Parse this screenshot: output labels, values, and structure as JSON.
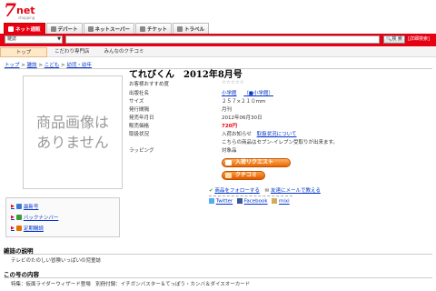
{
  "header": {
    "logo_seven": "7",
    "logo_net": "net",
    "logo_shopping": "shopping",
    "tabs": [
      {
        "label": "ネット通販",
        "active": true
      },
      {
        "label": "デパート",
        "active": false
      },
      {
        "label": "ネットスーパー",
        "active": false
      },
      {
        "label": "チケット",
        "active": false
      },
      {
        "label": "トラベル",
        "active": false
      }
    ]
  },
  "search": {
    "category": "雑誌",
    "placeholder": "",
    "button": "検 索",
    "advanced": "[詳細検索]"
  },
  "subnav": {
    "items": [
      "トップ",
      "こだわり専門店",
      "みんなのクチコミ"
    ]
  },
  "breadcrumb": {
    "top": "トップ",
    "magazine": "雑誌",
    "kids": "こども",
    "infant": "幼児・幼年",
    "sep": ">"
  },
  "product": {
    "no_image": "商品画像はありません",
    "title": "てれびくん　2012年8月号",
    "rows": [
      {
        "label": "お客様おすすめ度",
        "value": "☆☆☆☆☆"
      },
      {
        "label": "出版社名",
        "value": "小学館",
        "value2": "（■小学館）"
      },
      {
        "label": "サイズ",
        "value": "２５７×２１０mm"
      },
      {
        "label": "発行間隔",
        "value": "月刊"
      },
      {
        "label": "発売年月日",
        "value": "2012年06月30日"
      },
      {
        "label": "販売価格",
        "value": "720円"
      },
      {
        "label": "取扱状況",
        "value": "入荷お知らせ",
        "value2": "取扱状況について"
      },
      {
        "label": "",
        "value": "こちらの商品はセブン-イレブン受取りが出来ます。"
      },
      {
        "label": "ラッピング",
        "value": "対象品"
      }
    ],
    "btn_notify": "入荷リクエスト",
    "btn_review": "クチコミ",
    "follow": "商品をフォローする",
    "email": "友達にメールで教える",
    "twitter": "Twitter",
    "facebook": "Facebook",
    "mixi": "mixi"
  },
  "side_links": [
    {
      "label": "最新号",
      "color": "#3a7bd5"
    },
    {
      "label": "バックナンバー",
      "color": "#3a9a3a"
    },
    {
      "label": "定期購読",
      "color": "#e07000"
    }
  ],
  "sections": {
    "about_title": "雑誌の説明",
    "about_text": "テレビのたのしい冒険いっぱいの児童誌",
    "contents_title": "この号の内容",
    "contents_text": "特集：仮面ライダーウィザード登場　別冊付録：イチガンバスター＆てっぽう・カンバ＆ダイスオーカード"
  },
  "colors": {
    "brand_red": "#e60012",
    "link_blue": "#0033cc",
    "button_orange": "#e86800"
  }
}
